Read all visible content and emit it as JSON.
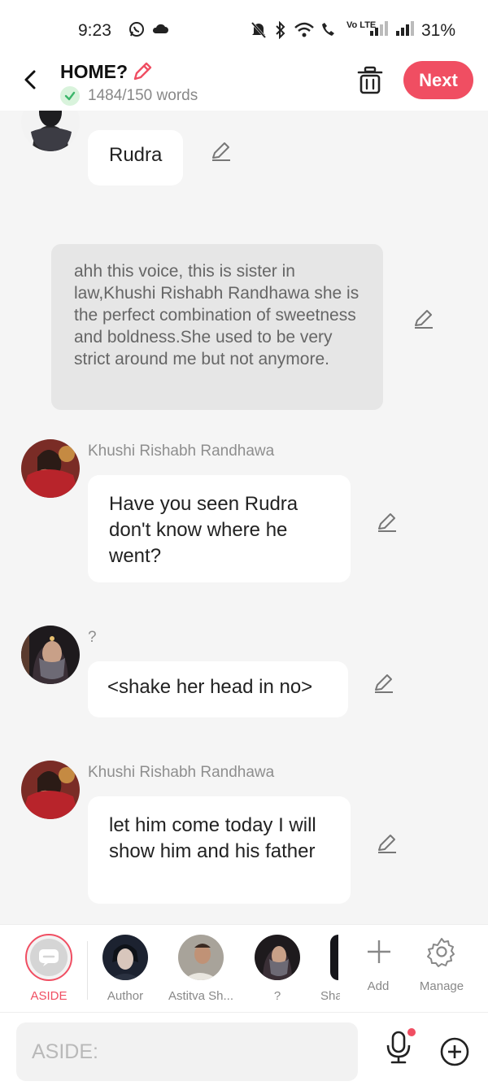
{
  "status_bar": {
    "time": "9:23",
    "battery": "31%",
    "network_label": "Vo LTE"
  },
  "header": {
    "title": "HOME?",
    "word_count": "1484/150 words",
    "next_label": "Next"
  },
  "messages": [
    {
      "type": "dialogue",
      "speaker": "",
      "text": "Rudra"
    },
    {
      "type": "narration",
      "text": "ahh this voice, this is sister in law,Khushi Rishabh Randhawa she is the perfect combination of sweetness and boldness.She used to be very strict around me but not anymore."
    },
    {
      "type": "dialogue",
      "speaker": "Khushi Rishabh Randhawa",
      "text": "Have you seen Rudra don't know where he went?"
    },
    {
      "type": "dialogue",
      "speaker": "?",
      "text": "<shake her head in no>"
    },
    {
      "type": "dialogue",
      "speaker": "Khushi Rishabh Randhawa",
      "text": "let him come today I will show him and his father"
    }
  ],
  "characters": [
    {
      "label": "ASIDE",
      "selected": true
    },
    {
      "label": "Author"
    },
    {
      "label": "Astitva Sh..."
    },
    {
      "label": "?"
    },
    {
      "label": "Sha"
    }
  ],
  "actions": {
    "add_label": "Add",
    "manage_label": "Manage"
  },
  "input": {
    "placeholder": "ASIDE:"
  },
  "colors": {
    "accent": "#f04e62",
    "background": "#f5f5f5",
    "bubble": "#ffffff",
    "narration_bg": "#e6e6e6"
  }
}
